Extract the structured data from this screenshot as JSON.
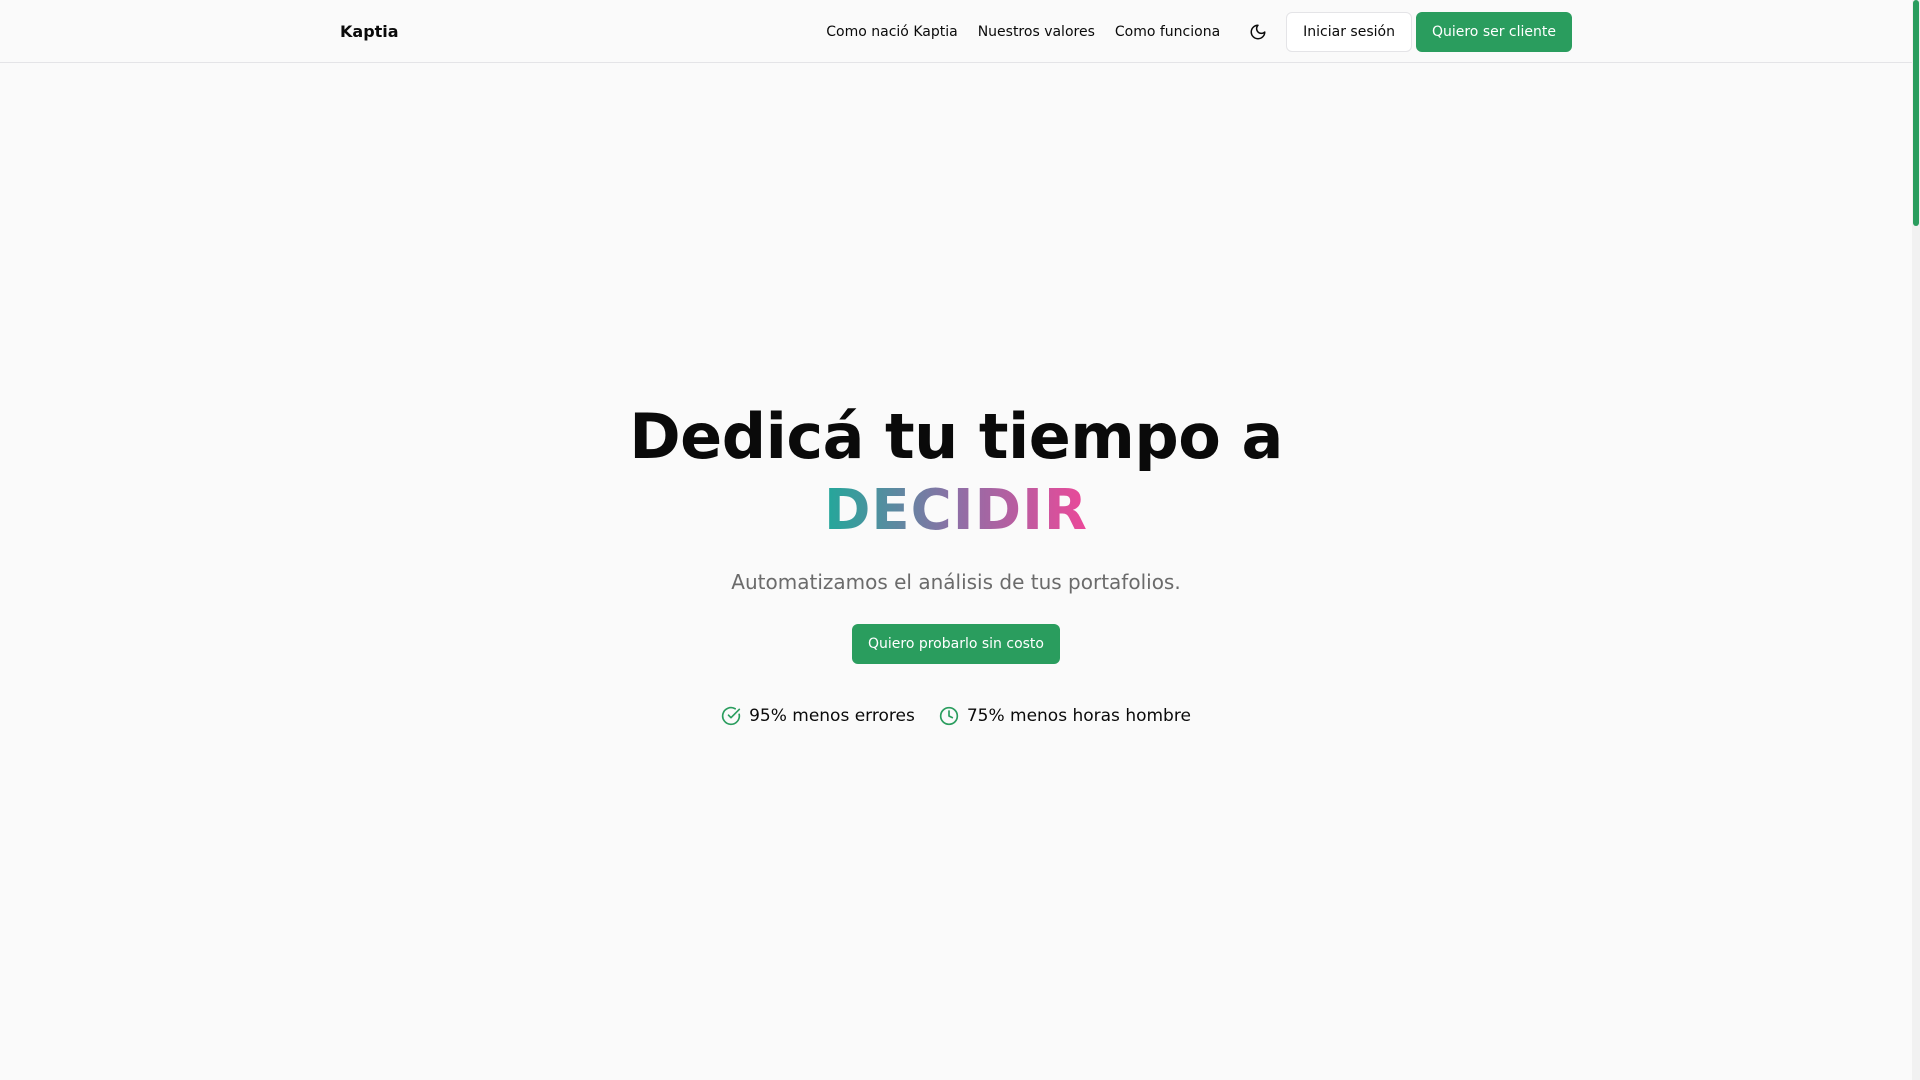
{
  "header": {
    "brand": "Kaptia",
    "nav": [
      {
        "label": "Como nació Kaptia"
      },
      {
        "label": "Nuestros valores"
      },
      {
        "label": "Como funciona"
      }
    ],
    "theme_toggle_icon": "moon-icon",
    "login_label": "Iniciar sesión",
    "signup_label": "Quiero ser cliente"
  },
  "hero": {
    "title": "Dedicá tu tiempo a",
    "highlight": "DECIDIR",
    "subtitle": "Automatizamos el análisis de tus portafolios.",
    "cta_label": "Quiero probarlo sin costo",
    "stats": [
      {
        "icon": "check-circle-icon",
        "label": "95% menos errores"
      },
      {
        "icon": "clock-icon",
        "label": "75% menos horas hombre"
      }
    ]
  },
  "colors": {
    "accent": "#2a9d5e",
    "background": "#fafafa",
    "gradient_start": "#22a89a",
    "gradient_end": "#ec4899"
  }
}
